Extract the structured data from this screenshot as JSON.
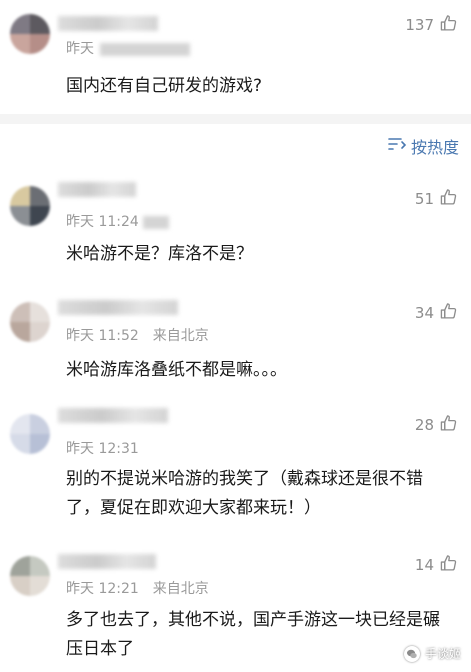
{
  "comments": [
    {
      "meta_time": "昨天",
      "likes": "137",
      "text": "国内还有自己研发的游戏?"
    },
    {
      "meta_time": "昨天 11:24",
      "likes": "51",
      "text": "米哈游不是？库洛不是？"
    },
    {
      "meta_time": "昨天 11:52",
      "meta_from": "来自北京",
      "likes": "34",
      "text": "米哈游库洛叠纸不都是嘛。。。"
    },
    {
      "meta_time": "昨天 12:31",
      "likes": "28",
      "text": "别的不提说米哈游的我笑了（戴森球还是很不错了，夏促在即欢迎大家都来玩！）"
    },
    {
      "meta_time": "昨天 12:21",
      "meta_from": "来自北京",
      "likes": "14",
      "text": "多了也去了，其他不说，国产手游这一块已经是碾压日本了"
    }
  ],
  "sort": {
    "label": "按热度"
  },
  "watermark": {
    "text": "手谈姬"
  },
  "colors": {
    "link_blue": "#4a78b0",
    "meta_gray": "#9a9a9a",
    "text_dark": "#1a1a1a"
  }
}
